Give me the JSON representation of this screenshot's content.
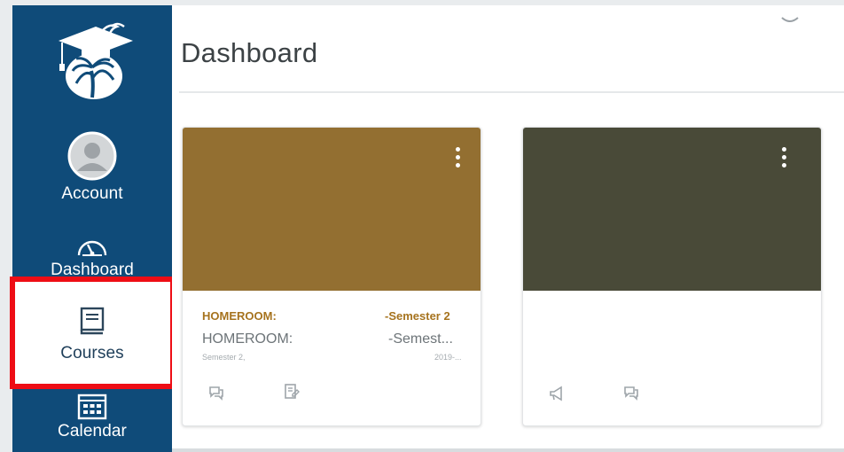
{
  "nav": {
    "items": [
      {
        "label": "Account",
        "icon": "user-avatar-icon"
      },
      {
        "label": "Dashboard",
        "icon": "speedometer-icon"
      },
      {
        "label": "Courses",
        "icon": "book-icon"
      },
      {
        "label": "Calendar",
        "icon": "calendar-icon"
      }
    ]
  },
  "main": {
    "title": "Dashboard"
  },
  "cards": [
    {
      "color": "#936f31",
      "code_left": "HOMEROOM:",
      "code_right": "-Semester 2",
      "name_left": "HOMEROOM:",
      "name_right": "-Semest...",
      "term_left": "Semester 2,",
      "term_right": "2019-...",
      "icons": [
        "discussions-icon",
        "assignments-icon"
      ]
    },
    {
      "color": "#494a38",
      "code_left": "",
      "code_right": "",
      "name_left": "",
      "name_right": "",
      "term_left": "",
      "term_right": "",
      "icons": [
        "announcements-icon",
        "discussions-icon"
      ]
    }
  ],
  "colors": {
    "nav_bg": "#0f4b79",
    "highlight": "#ee0d15",
    "accent_text": "#a6731e"
  }
}
